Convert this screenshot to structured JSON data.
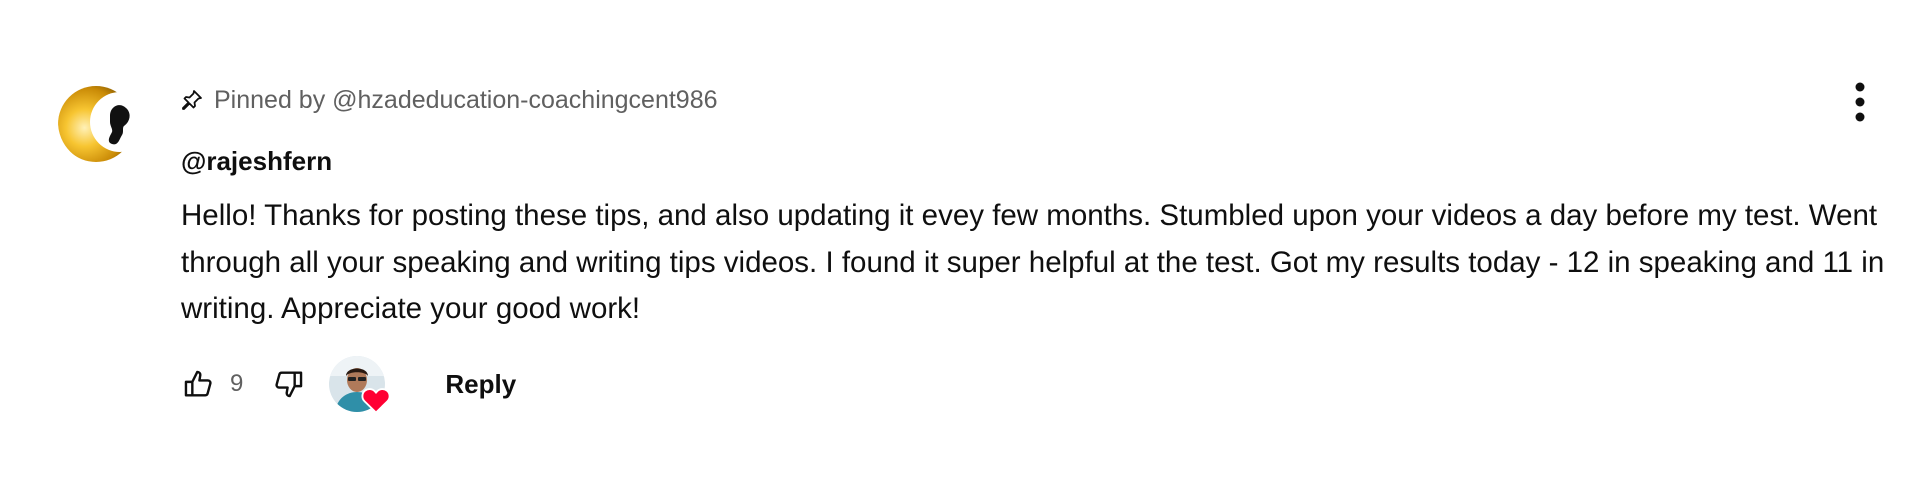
{
  "comment": {
    "pinned_text": "Pinned by @hzadeducation-coachingcent986",
    "author": "@rajeshfern",
    "text": "Hello! Thanks for posting these tips, and also updating it evey few months. Stumbled upon your videos a day before my test. Went through all your speaking and writing tips videos. I found it super helpful at the test. Got my results today - 12 in speaking and 11 in writing. Appreciate your good work!",
    "like_count": "9",
    "reply_label": "Reply"
  },
  "icons": {
    "pin": "pin-icon",
    "like": "thumbs-up-icon",
    "dislike": "thumbs-down-icon",
    "heart": "heart-icon",
    "menu": "more-vertical-icon"
  },
  "colors": {
    "heart": "#ff0033",
    "secondary_text": "#606060",
    "primary_text": "#0f0f0f",
    "avatar_gold": "#f5b316"
  }
}
